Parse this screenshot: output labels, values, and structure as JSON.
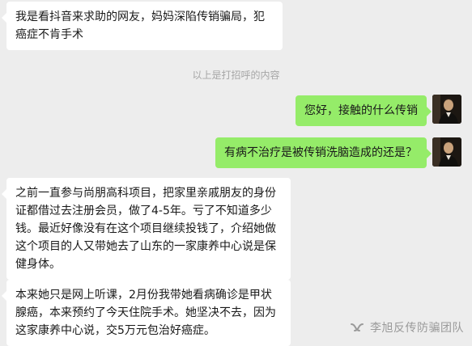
{
  "chat": {
    "messages": [
      {
        "side": "left",
        "text": "我是看抖音来求助的网友，妈妈深陷传销骗局，犯癌症不肯手术"
      },
      {
        "side": "right",
        "text": "您好，接触的什么传销"
      },
      {
        "side": "right",
        "text": "有病不治疗是被传销洗脑造成的还是？"
      },
      {
        "side": "left",
        "text": "之前一直参与尚朋高科项目，把家里亲戚朋友的身份证都借过去注册会员，做了4-5年。亏了不知道多少钱。最近好像没有在这个项目继续投钱了，介绍她做这个项目的人又带她去了山东的一家康养中心说是保健身体。"
      },
      {
        "side": "left",
        "text": "本来她只是网上听课，2月份我带她看病确诊是甲状腺癌，本来预约了今天住院手术。她坚决不去，因为这家康养中心说，交5万元包治好癌症。"
      }
    ],
    "system_tip": "以上是打招呼的内容"
  },
  "watermark": {
    "text": "李旭反传防骗团队",
    "icon": "wechat-channel-icon"
  },
  "colors": {
    "background": "#ededed",
    "bubble_self": "#95ec69",
    "bubble_other": "#ffffff",
    "tip_text": "#a6a6a6"
  }
}
